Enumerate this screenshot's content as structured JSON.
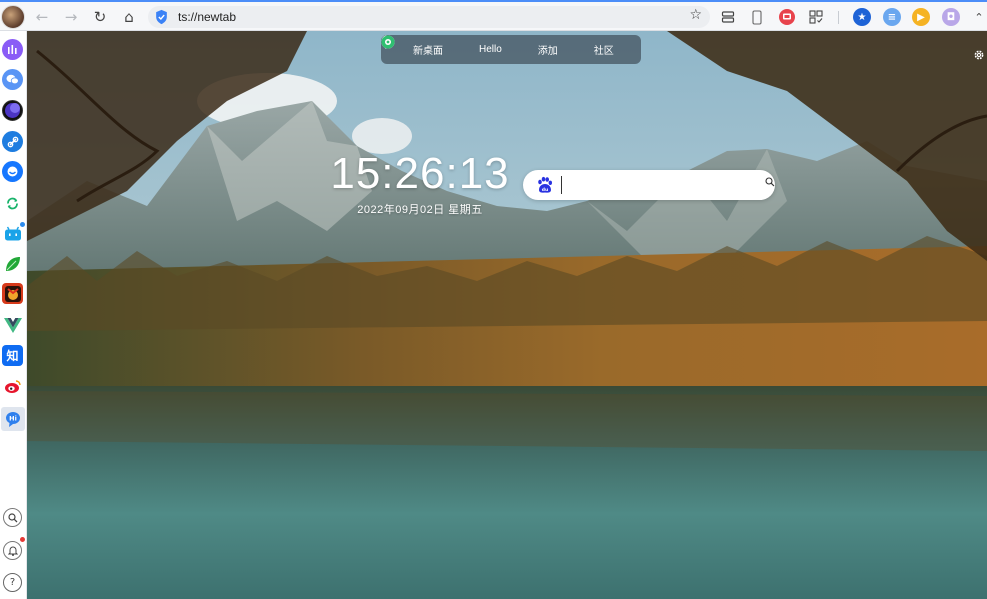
{
  "browser": {
    "url": "ts://newtab",
    "toolbar_icons": [
      "back-icon",
      "forward-icon",
      "reload-icon",
      "home-icon",
      "bookmark-star-icon",
      "reading-list-icon",
      "device-icon",
      "screenshot-icon",
      "qr-icon"
    ],
    "extensions": [
      {
        "name": "star-extension-icon",
        "color": "#1e63d6"
      },
      {
        "name": "notes-extension-icon",
        "color": "#6aa7ef"
      },
      {
        "name": "video-extension-icon",
        "color": "#f5b324"
      },
      {
        "name": "lock-extension-icon",
        "color": "#b9a7e8"
      }
    ]
  },
  "sidebar": {
    "items": [
      {
        "name": "music-app-icon",
        "color": "#8a5cf6"
      },
      {
        "name": "wechat-icon",
        "color": "#5a95f5"
      },
      {
        "name": "moon-app-icon",
        "color": "#4c35c4"
      },
      {
        "name": "link-app-icon",
        "color": "#1e7de0"
      },
      {
        "name": "circle-app-icon",
        "color": "#1677ff"
      },
      {
        "name": "sync-app-icon",
        "color": "#19b36b"
      },
      {
        "name": "bilibili-icon",
        "color": "#1aa3e8"
      },
      {
        "name": "leaf-app-icon",
        "color": "#22a838"
      },
      {
        "name": "game-app-icon",
        "color": "#d73a1b"
      },
      {
        "name": "vue-icon",
        "color": "#41b883"
      },
      {
        "name": "zhihu-icon",
        "color": "#0f6cf2",
        "label": "知"
      },
      {
        "name": "weibo-icon",
        "color": "#e6162d"
      },
      {
        "name": "chat-app-icon",
        "color": "#2f80ed",
        "label": "Hi"
      }
    ],
    "bottom": [
      {
        "name": "sidebar-search-icon",
        "glyph": "⌕"
      },
      {
        "name": "notification-bell-icon",
        "glyph": "🔔"
      },
      {
        "name": "help-icon",
        "glyph": "?"
      }
    ]
  },
  "newtab": {
    "top_menu": [
      {
        "icon": "bulb-icon",
        "label": "新桌面"
      },
      {
        "icon": "bulb-icon",
        "label": "Hello"
      },
      {
        "icon": "add-circle-icon",
        "label": "添加"
      },
      {
        "icon": "community-icon",
        "label": "社区"
      }
    ],
    "clock": "15:26:13",
    "date": "2022年09月02日  星期五",
    "search": {
      "placeholder": "",
      "engine": "baidu-icon"
    }
  },
  "colors": {
    "accent": "#4b8df8",
    "pill_bg": "rgba(40,48,56,0.55)"
  }
}
